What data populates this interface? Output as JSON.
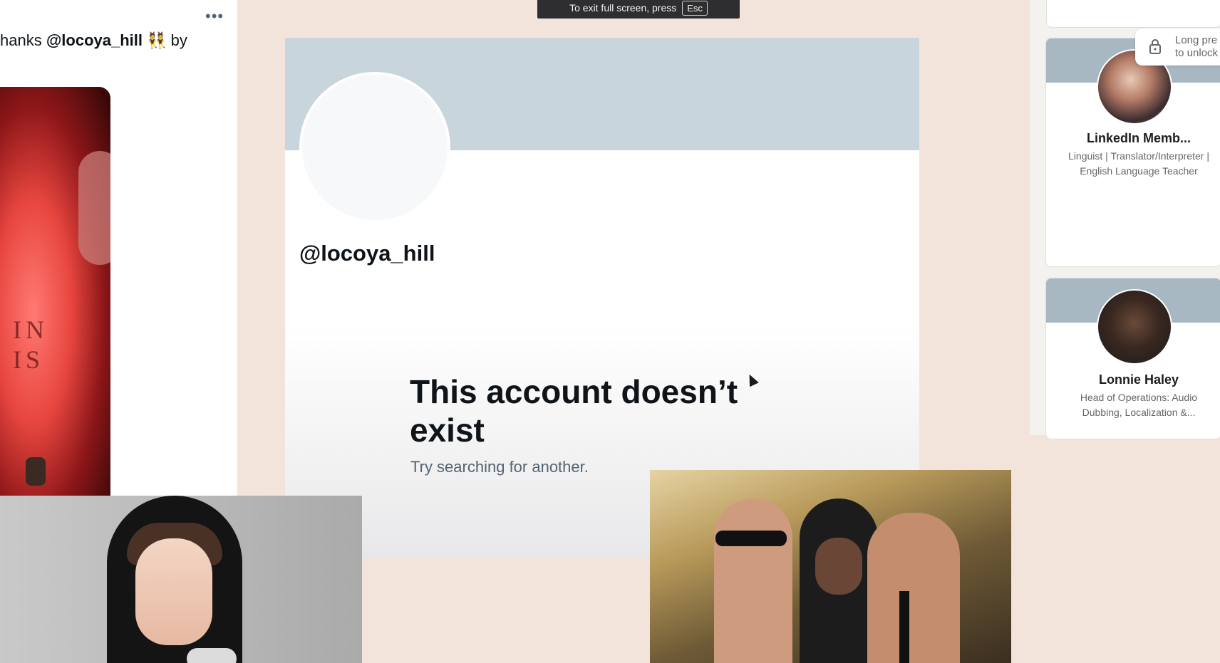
{
  "fullscreen_bar": {
    "text": "To exit full screen, press",
    "key": "Esc"
  },
  "tweet": {
    "menu": "•••",
    "text_prefix": "hanks ",
    "mention": "@locoya_hill",
    "emoji": "👯",
    "text_suffix": " by"
  },
  "profile": {
    "handle": "@locoya_hill",
    "error_title": "This account doesn’t exist",
    "error_subtitle": "Try searching for another."
  },
  "linkedin": {
    "lock_text_line1": "Long pre",
    "lock_text_line2": "to unlock",
    "cards": [
      {
        "name": "LinkedIn Memb...",
        "desc_line1": "Linguist | Translator/Interpreter |",
        "desc_line2": "English Language Teacher"
      },
      {
        "name": "Lonnie Haley",
        "desc_line1": "Head of Operations: Audio",
        "desc_line2": "Dubbing, Localization &..."
      }
    ]
  },
  "shirt_text": "IN\nIS",
  "colors": {
    "banner": "#c9d5dc",
    "background": "#f2e4da",
    "fullscreen_bar": "#2e2e30"
  }
}
